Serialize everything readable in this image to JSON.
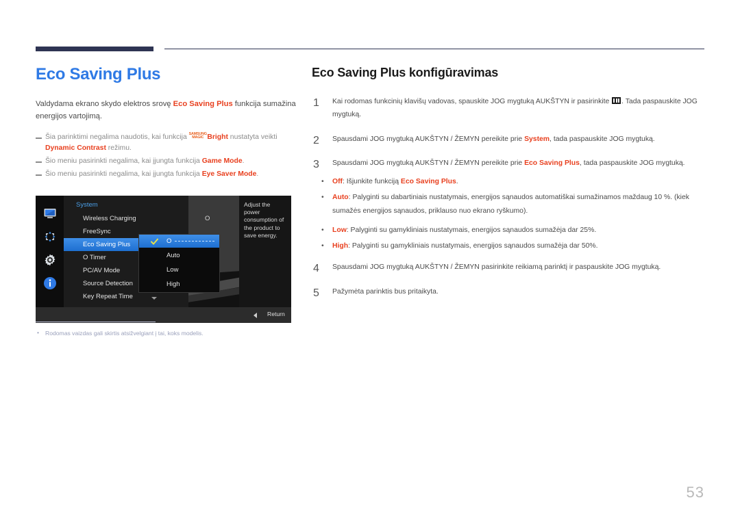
{
  "document": {
    "page_number": "53"
  },
  "left": {
    "title": "Eco Saving Plus",
    "intro_before": "Valdydama ekrano skydo elektros srovę ",
    "intro_hl": "Eco Saving Plus",
    "intro_after": " funkcija sumažina energijos vartojimą.",
    "notes": [
      {
        "part1": "Šia parinktimi negalima naudotis, kai funkcija ",
        "magic_top": "SAMSUNG",
        "magic_bottom": "MAGIC",
        "hl1": "Bright",
        "part2": " nustatyta veikti ",
        "hl2": "Dynamic Contrast",
        "part3": " režimu."
      },
      {
        "part1": "Šio meniu pasirinkti negalima, kai įjungta funkcija ",
        "hl1": "Game Mode",
        "part2": "."
      },
      {
        "part1": "Šio meniu pasirinkti negalima, kai įjungta funkcija ",
        "hl1": "Eye Saver Mode",
        "part2": "."
      }
    ],
    "footnote": "Rodomas vaizdas gali skirtis atsižvelgiant į tai, koks modelis."
  },
  "osd": {
    "menu_title": "System",
    "items": [
      {
        "label": "Wireless Charging",
        "selected": false
      },
      {
        "label": "FreeSync",
        "selected": false
      },
      {
        "label": "Eco Saving Plus",
        "selected": true
      },
      {
        "label": "O  Timer",
        "selected": false
      },
      {
        "label": "PC/AV Mode",
        "selected": false
      },
      {
        "label": "Source Detection",
        "selected": false
      },
      {
        "label": "Key Repeat Time",
        "selected": false
      }
    ],
    "right_value": "O",
    "description": "Adjust the power consumption of the product to save energy.",
    "dropdown": [
      {
        "label": "O",
        "selected": true
      },
      {
        "label": "Auto",
        "selected": false
      },
      {
        "label": "Low",
        "selected": false
      },
      {
        "label": "High",
        "selected": false
      }
    ],
    "footer_text": "Return",
    "icons": [
      "monitor-icon",
      "picture-position-icon",
      "gear-icon",
      "info-icon"
    ],
    "accent_color": "#2f7ae5"
  },
  "right": {
    "section_title": "Eco Saving Plus konfigūravimas",
    "steps": [
      {
        "num": "1",
        "pre": "Kai rodomas funkcinių klavišų vadovas, spauskite JOG mygtuką AUKŠTYN ir pasirinkite ",
        "post": ". Tada paspauskite JOG mygtuką."
      },
      {
        "num": "2",
        "pre": "Spausdami JOG mygtuką AUKŠTYN / ŽEMYN pereikite prie ",
        "hl": "System",
        "post": ", tada paspauskite JOG mygtuką."
      },
      {
        "num": "3",
        "pre": "Spausdami JOG mygtuką AUKŠTYN / ŽEMYN pereikite prie ",
        "hl": "Eco Saving Plus",
        "post": ", tada paspauskite JOG mygtuką."
      }
    ],
    "options": [
      {
        "hl": "Off",
        "mid": ": Išjunkite funkciją ",
        "hl2": "Eco Saving Plus",
        "tail": "."
      },
      {
        "hl": "Auto",
        "mid": ": Palyginti su dabartiniais nustatymais, energijos sąnaudos automatiškai sumažinamos maždaug 10 %. (kiek sumažės energijos sąnaudos, priklauso nuo ekrano ryškumo)."
      },
      {
        "hl": "Low",
        "mid": ": Palyginti su gamykliniais nustatymais, energijos sąnaudos sumažėja dar 25%."
      },
      {
        "hl": "High",
        "mid": ": Palyginti su gamykliniais nustatymais, energijos sąnaudos sumažėja dar 50%."
      }
    ],
    "step4": {
      "num": "4",
      "text": "Spausdami JOG mygtuką AUKŠTYN / ŽEMYN pasirinkite reikiamą parinktį ir paspauskite JOG mygtuką."
    },
    "step5": {
      "num": "5",
      "text": "Pažymėta parinktis bus pritaikyta."
    }
  }
}
